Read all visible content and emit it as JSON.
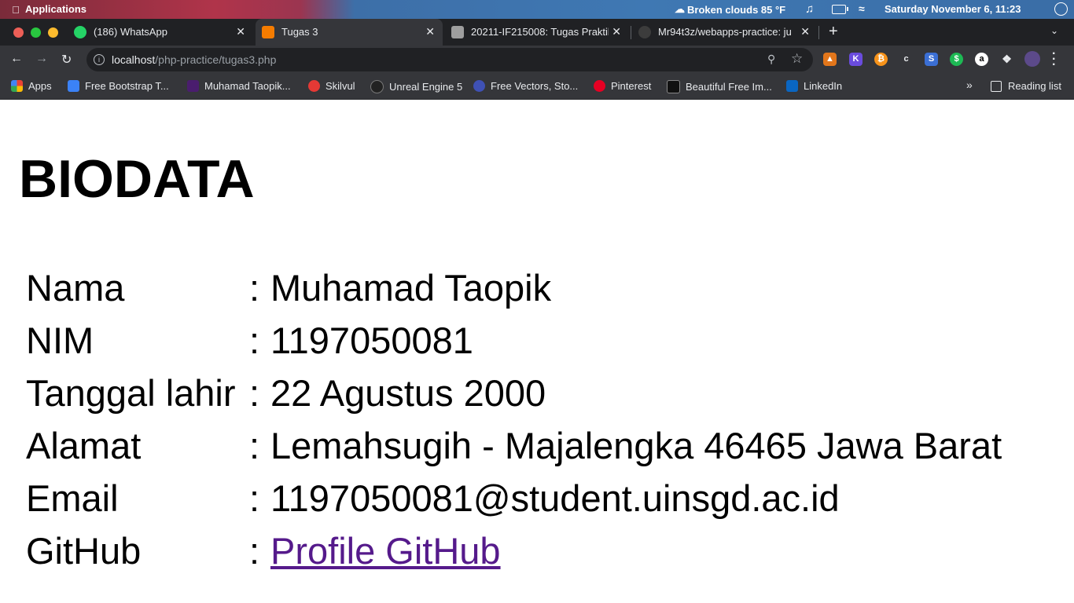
{
  "os_bar": {
    "apps_label": "Applications",
    "weather": "Broken clouds 85 °F",
    "datetime": "Saturday November  6, 11:23"
  },
  "tabs": [
    {
      "title": "(186) WhatsApp",
      "favicon_color": "#25d366",
      "active": false
    },
    {
      "title": "Tugas 3",
      "favicon_color": "#f57c00",
      "active": true
    },
    {
      "title": "20211-IF215008: Tugas Praktik",
      "favicon_color": "#9e9e9e",
      "active": false
    },
    {
      "title": "Mr94t3z/webapps-practice: ju",
      "favicon_color": "#3c3c3c",
      "active": false
    }
  ],
  "address_bar": {
    "host": "localhost",
    "path": "/php-practice/tugas3.php"
  },
  "bookmarks": [
    {
      "label": "Apps",
      "icon_color": "#4285f4"
    },
    {
      "label": "Free Bootstrap T...",
      "icon_color": "#3b82f6"
    },
    {
      "label": "Muhamad Taopik...",
      "icon_color": "#4a1d6e"
    },
    {
      "label": "Skilvul",
      "icon_color": "#e53935"
    },
    {
      "label": "Unreal Engine 5",
      "icon_color": "#222222"
    },
    {
      "label": "Free Vectors, Sto...",
      "icon_color": "#3f51b5"
    },
    {
      "label": "Pinterest",
      "icon_color": "#e60023"
    },
    {
      "label": "Beautiful Free Im...",
      "icon_color": "#111111"
    },
    {
      "label": "LinkedIn",
      "icon_color": "#0a66c2"
    }
  ],
  "reading_list_label": "Reading list",
  "page": {
    "heading": "BIODATA",
    "separator": ":",
    "rows": [
      {
        "label": "Nama",
        "value": "Muhamad Taopik"
      },
      {
        "label": "NIM",
        "value": "1197050081"
      },
      {
        "label": "Tanggal lahir",
        "value": "22 Agustus 2000"
      },
      {
        "label": "Alamat",
        "value": "Lemahsugih - Majalengka 46465 Jawa Barat"
      },
      {
        "label": "Email",
        "value": "1197050081@student.uinsgd.ac.id"
      },
      {
        "label": "GitHub",
        "value": "Profile GitHub",
        "is_link": true
      }
    ]
  }
}
